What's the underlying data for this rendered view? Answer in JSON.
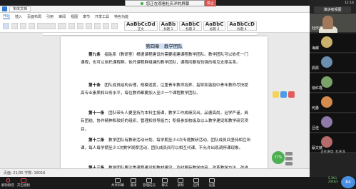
{
  "share_banner": {
    "text": "您正在观看杜庆洋的屏幕",
    "stop_label": "停止"
  },
  "word": {
    "doc_tab": "宋体文档",
    "menu": [
      "开始",
      "插入",
      "页面布局",
      "引用",
      "审阅",
      "视图",
      "章节",
      "开发工具",
      "特色功能"
    ],
    "styles": [
      {
        "sample": "AaBbCcDd",
        "name": "正文"
      },
      {
        "sample": "AaBb",
        "name": "标题 1"
      },
      {
        "sample": "AaBbC",
        "name": "标题 2"
      },
      {
        "sample": "AaBbC",
        "name": "标题 3"
      },
      {
        "sample": "AaBbCcD",
        "name": "标题 4"
      }
    ],
    "status": "页面: 21/35   字数: 18016"
  },
  "document": {
    "chapter_title": "第四章　教学团队",
    "paragraphs": [
      {
        "lead": "第九条",
        "text": "指贴系（教研室）根据课程建设的需要组建课程教学团队。教学团队可以依托一门课程，也可以依托课程群。依托课程群组建的教学团队，课程间要有较强的相互支撑关系。"
      },
      {
        "lead": "第十条",
        "text": "团队成员结构合理，规模适度，注重青年教师培养，指导和激励中青年教师尽快提高专业素质和业务水平，每位教师都要加入至少一个课程教学团队。"
      },
      {
        "lead": "第十一条",
        "text": "团队带头人要坚持为本科生授课，教学工作成绩突出，品德高尚，治学严谨，具有团结、协作精神和较好的组织、管理和领导能力；积极参加校级及以上教学建设和教学研究项目。"
      },
      {
        "lead": "第十二条",
        "text": "教学团队有教研活动计划，每学期至少4次专题教研活动，团队成员间坚持相互听课，每人每学期至少3次教学观摩活动，团队成员间可以相互代课，不允许出现调停课现象。"
      },
      {
        "lead": "第十三条",
        "text": "教学团队要注重课程建设和教材建设，及时更新教学内容，改革教学方法，改进考核方式，不断提高教学质量，成员教学效果"
      }
    ]
  },
  "float_tools": {
    "percent": "77%"
  },
  "meeting": {
    "time": "12:16",
    "view_label": "演讲者视图",
    "speaking": "正在讲话: 杜庆洋",
    "participants": [
      {
        "name": "杜庆洋",
        "kind": "video"
      },
      {
        "name": "海蝶",
        "color": "#c9b06b"
      },
      {
        "name": "辰辰",
        "color": "#6c8fb0"
      },
      {
        "name": "徐红霞",
        "color": "#7aa36a"
      },
      {
        "name": "何勇",
        "color": "#d58a4e"
      },
      {
        "name": "吕佳",
        "color": "#8e7aa8"
      },
      {
        "name": "蔡文婧",
        "color": "#b56b6b"
      }
    ],
    "toolbar": [
      {
        "label": "解除静音",
        "kind": "mic",
        "red": true
      },
      {
        "label": "开启视频",
        "kind": "cam",
        "red": true
      },
      {
        "label": "共享屏幕",
        "kind": "share"
      },
      {
        "label": "邀请",
        "kind": "invite"
      },
      {
        "label": "管理成员",
        "kind": "members"
      },
      {
        "label": "聊天",
        "kind": "chat"
      },
      {
        "label": "录制",
        "kind": "record"
      },
      {
        "label": "应用",
        "kind": "apps"
      },
      {
        "label": "设置",
        "kind": "settings"
      }
    ],
    "network": [
      "5.3K/s",
      "204K/s"
    ],
    "score": "84"
  }
}
